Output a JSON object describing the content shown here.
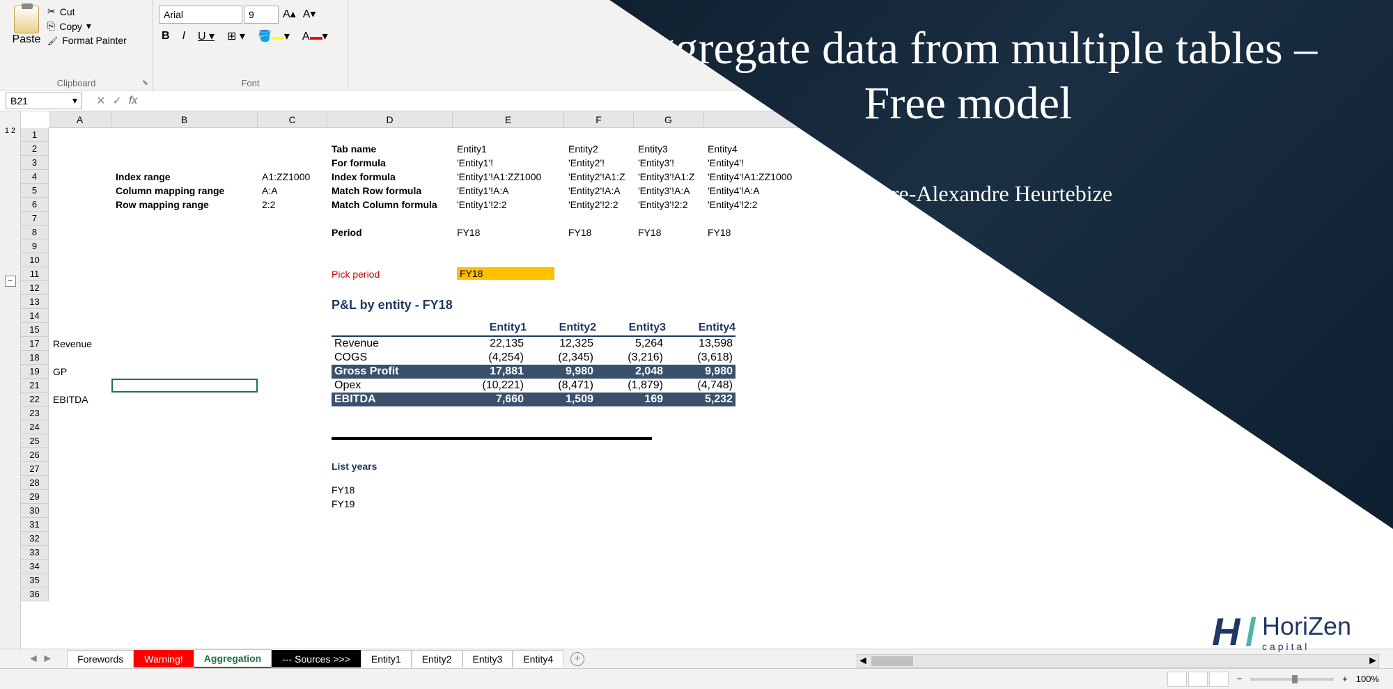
{
  "ribbon": {
    "paste": "Paste",
    "cut": "Cut",
    "copy": "Copy",
    "format_painter": "Format Painter",
    "clipboard_label": "Clipboard",
    "font_label": "Font",
    "font_name": "Arial",
    "font_size": "9"
  },
  "name_box": "B21",
  "columns": [
    "A",
    "B",
    "C",
    "D",
    "E",
    "F",
    "G"
  ],
  "rows": [
    "1",
    "2",
    "3",
    "4",
    "5",
    "6",
    "7",
    "8",
    "9",
    "10",
    "11",
    "12",
    "13",
    "14",
    "15",
    "17",
    "18",
    "19",
    "21",
    "22",
    "23",
    "24",
    "25",
    "26",
    "27",
    "28",
    "29",
    "30",
    "31",
    "32",
    "33",
    "34",
    "35",
    "36"
  ],
  "labels": {
    "tab_name": "Tab name",
    "for_formula": "For formula",
    "index_range": "Index range",
    "col_map_range": "Column mapping range",
    "row_map_range": "Row mapping range",
    "index_formula": "Index formula",
    "match_row": "Match Row formula",
    "match_col": "Match Column formula",
    "period": "Period",
    "pick_period": "Pick period",
    "table_title": "P&L by entity - FY18",
    "list_years": "List years"
  },
  "values": {
    "index_range": "A1:ZZ1000",
    "col_map_range": "A:A",
    "row_map_range": "2:2",
    "picked_period": "FY18"
  },
  "entities": [
    "Entity1",
    "Entity2",
    "Entity3",
    "Entity4"
  ],
  "for_formula_vals": [
    "'Entity1'!",
    "'Entity2'!",
    "'Entity3'!",
    "'Entity4'!"
  ],
  "index_formula_vals": [
    "'Entity1'!A1:ZZ1000",
    "'Entity2'!A1:Z",
    "'Entity3'!A1:Z",
    "'Entity4'!A1:ZZ1000"
  ],
  "match_row_vals": [
    "'Entity1'!A:A",
    "'Entity2'!A:A",
    "'Entity3'!A:A",
    "'Entity4'!A:A"
  ],
  "match_col_vals": [
    "'Entity1'!2:2",
    "'Entity2'!2:2",
    "'Entity3'!2:2",
    "'Entity4'!2:2"
  ],
  "periods": [
    "FY18",
    "FY18",
    "FY18",
    "FY18"
  ],
  "row_labels": {
    "r17": "Revenue",
    "r19": "GP",
    "r22": "EBITDA"
  },
  "chart_data": {
    "type": "table",
    "title": "P&L by entity - FY18",
    "columns": [
      "Entity1",
      "Entity2",
      "Entity3",
      "Entity4"
    ],
    "rows": [
      {
        "label": "Revenue",
        "values": [
          "22,135",
          "12,325",
          "5,264",
          "13,598"
        ]
      },
      {
        "label": "COGS",
        "values": [
          "(4,254)",
          "(2,345)",
          "(3,216)",
          "(3,618)"
        ]
      },
      {
        "label": "Gross Profit",
        "values": [
          "17,881",
          "9,980",
          "2,048",
          "9,980"
        ],
        "highlight": true
      },
      {
        "label": "Opex",
        "values": [
          "(10,221)",
          "(8,471)",
          "(1,879)",
          "(4,748)"
        ]
      },
      {
        "label": "EBITDA",
        "values": [
          "7,660",
          "1,509",
          "169",
          "5,232"
        ],
        "highlight": true
      }
    ]
  },
  "years": [
    "FY18",
    "FY19"
  ],
  "tabs": [
    "Forewords",
    "Warning!",
    "Aggregation",
    "--- Sources >>>",
    "Entity1",
    "Entity2",
    "Entity3",
    "Entity4"
  ],
  "overlay": {
    "title": "Aggregate data from multiple tables – Free model",
    "author": "By Pierre-Alexandre Heurtebize",
    "logo_text": "HoriZen",
    "logo_sub": "capital"
  },
  "zoom": "100%"
}
